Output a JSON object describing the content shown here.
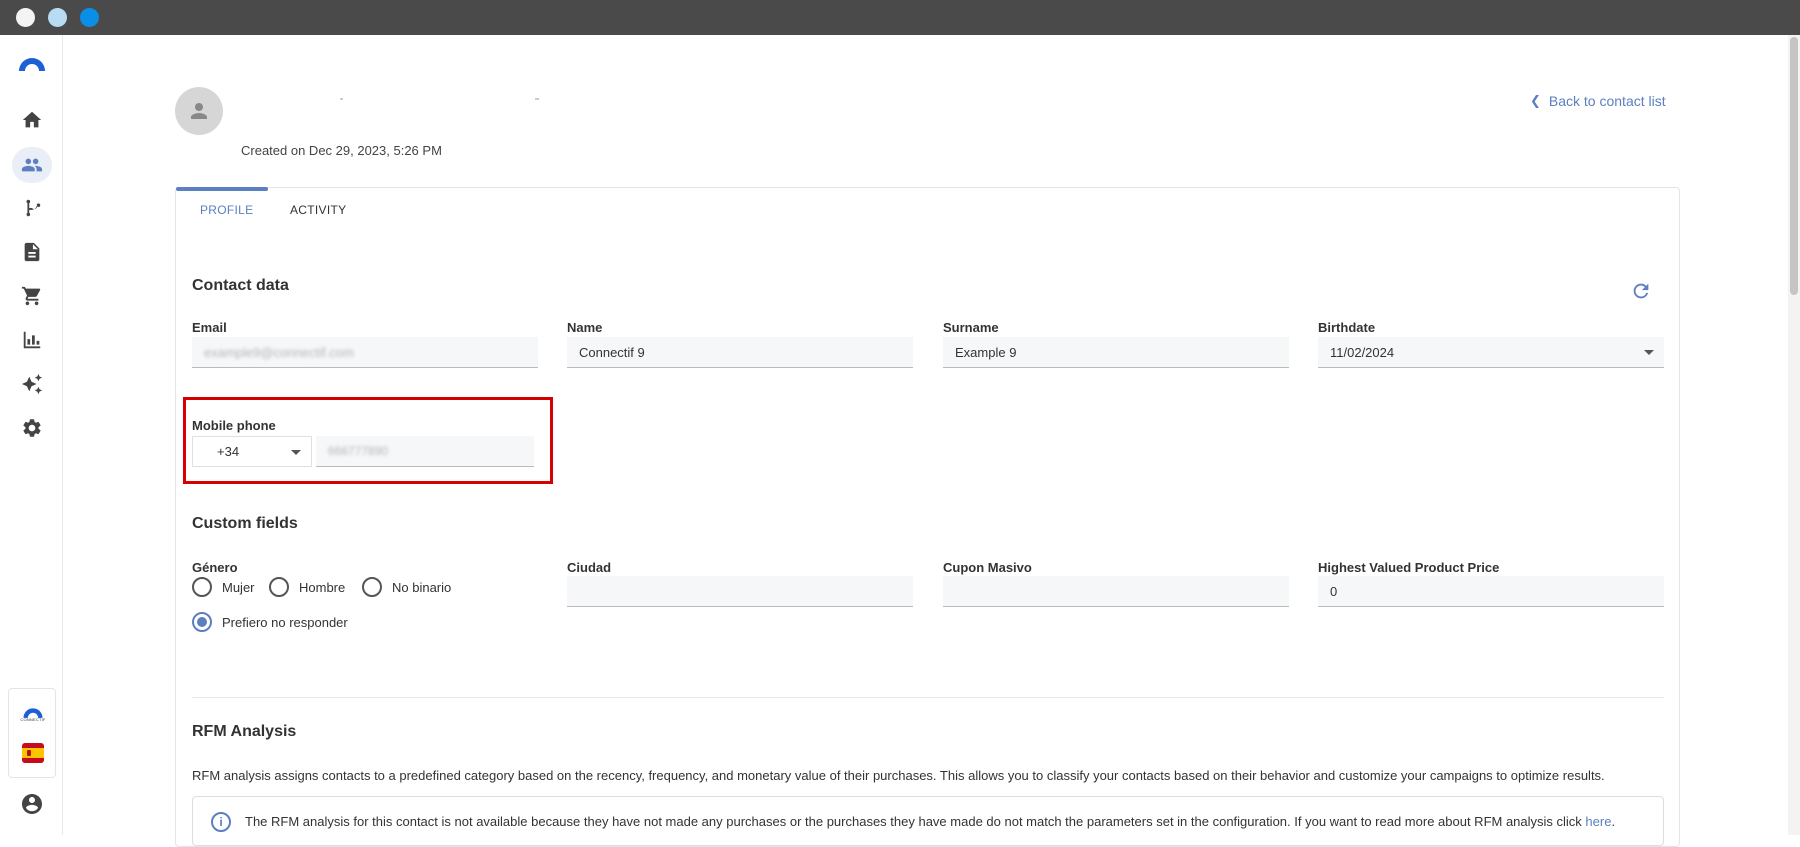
{
  "window": {
    "controls": [
      "close",
      "minimize",
      "maximize"
    ]
  },
  "sidebar": {
    "items": [
      {
        "name": "home-icon",
        "active": false
      },
      {
        "name": "contacts-icon",
        "active": true
      },
      {
        "name": "workflow-icon",
        "active": false
      },
      {
        "name": "document-icon",
        "active": false
      },
      {
        "name": "cart-icon",
        "active": false
      },
      {
        "name": "chart-icon",
        "active": false
      },
      {
        "name": "sparkle-icon",
        "active": false
      },
      {
        "name": "gear-icon",
        "active": false
      }
    ],
    "brand_text": "CONNECTIF",
    "language_flag": "spain-flag-icon",
    "user_icon": "account-circle-icon"
  },
  "header": {
    "created_text": "Created on Dec 29, 2023, 5:26 PM",
    "back_link": "Back to contact list"
  },
  "tabs": [
    {
      "label": "PROFILE",
      "active": true
    },
    {
      "label": "ACTIVITY",
      "active": false
    }
  ],
  "contact_data": {
    "title": "Contact data",
    "email": {
      "label": "Email",
      "value": "example9@connectif.com"
    },
    "name": {
      "label": "Name",
      "value": "Connectif 9"
    },
    "surname": {
      "label": "Surname",
      "value": "Example 9"
    },
    "birthdate": {
      "label": "Birthdate",
      "value": "11/02/2024"
    },
    "mobile_phone": {
      "label": "Mobile phone",
      "prefix": "+34",
      "number": "666777890"
    }
  },
  "custom_fields": {
    "title": "Custom fields",
    "genero": {
      "label": "Género",
      "options": [
        {
          "label": "Mujer",
          "checked": false
        },
        {
          "label": "Hombre",
          "checked": false
        },
        {
          "label": "No binario",
          "checked": false
        },
        {
          "label": "Prefiero no responder",
          "checked": true
        }
      ]
    },
    "ciudad": {
      "label": "Ciudad",
      "value": ""
    },
    "cupon": {
      "label": "Cupon Masivo",
      "value": ""
    },
    "highest": {
      "label": "Highest Valued Product Price",
      "value": "0"
    }
  },
  "rfm": {
    "title": "RFM Analysis",
    "description": "RFM analysis assigns contacts to a predefined category based on the recency, frequency, and monetary value of their purchases. This allows you to classify your contacts based on their behavior and customize your campaigns to optimize results.",
    "info_text": "The RFM analysis for this contact is not available because they have not made any purchases or the purchases they have made do not match the parameters set in the configuration. If you want to read more about RFM analysis click ",
    "info_link": "here",
    "info_end": "."
  },
  "colors": {
    "accent": "#5b7fc0",
    "highlight": "#d70000"
  }
}
